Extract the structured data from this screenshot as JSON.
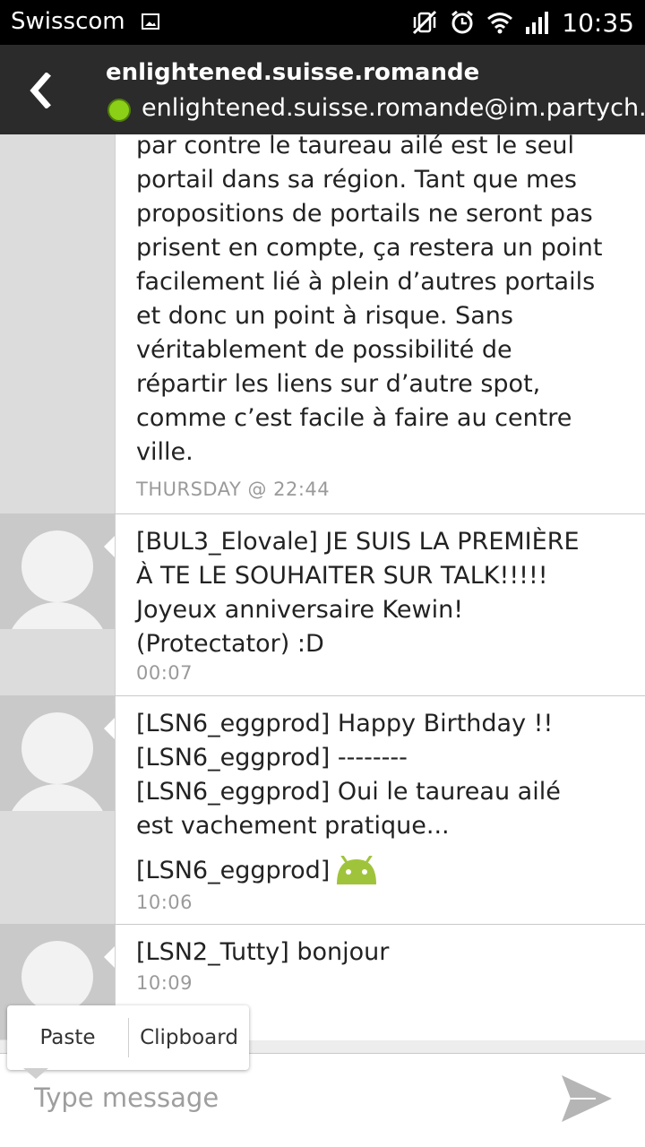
{
  "status_bar": {
    "carrier": "Swisscom",
    "time": "10:35",
    "icons": [
      "gallery-icon",
      "vibrate-off-icon",
      "alarm-icon",
      "wifi-icon",
      "signal-icon"
    ]
  },
  "header": {
    "contact_name": "enlightened.suisse.romande",
    "contact_email": "enlightened.suisse.romande@im.partych.at",
    "presence_color": "#8ccf17"
  },
  "messages": [
    {
      "lines": [
        "par contre le taureau ailé est le seul",
        "portail dans sa région. Tant que mes",
        "propositions de portails ne seront pas",
        "prisent en compte, ça restera un point",
        "facilement lié à plein d’autres portails",
        "et donc un point à risque. Sans",
        "véritablement de possibilité de",
        "répartir les liens sur d’autre spot,",
        "comme c’est facile à faire au centre",
        "ville."
      ],
      "time": "THURSDAY @ 22:44"
    },
    {
      "lines": [
        "[BUL3_Elovale] JE SUIS LA PREMIÈRE",
        "À TE LE SOUHAITER SUR TALK!!!!!",
        "Joyeux anniversaire Kewin!",
        "(Protectator) :D"
      ],
      "time": "00:07"
    },
    {
      "lines": [
        "[LSN6_eggprod] Happy Birthday !!",
        "[LSN6_eggprod] --------",
        "[LSN6_eggprod] Oui le taureau ailé",
        "est vachement pratique..."
      ],
      "last_line": "[LSN6_eggprod]",
      "time": "10:06"
    },
    {
      "lines": [
        "[LSN2_Tutty] bonjour"
      ],
      "time": "10:09"
    }
  ],
  "popup": {
    "paste_label": "Paste",
    "clipboard_label": "Clipboard"
  },
  "composer": {
    "placeholder": "Type message",
    "value": ""
  },
  "colors": {
    "android_green": "#9fc43b",
    "send_icon": "#b5b5b5"
  }
}
